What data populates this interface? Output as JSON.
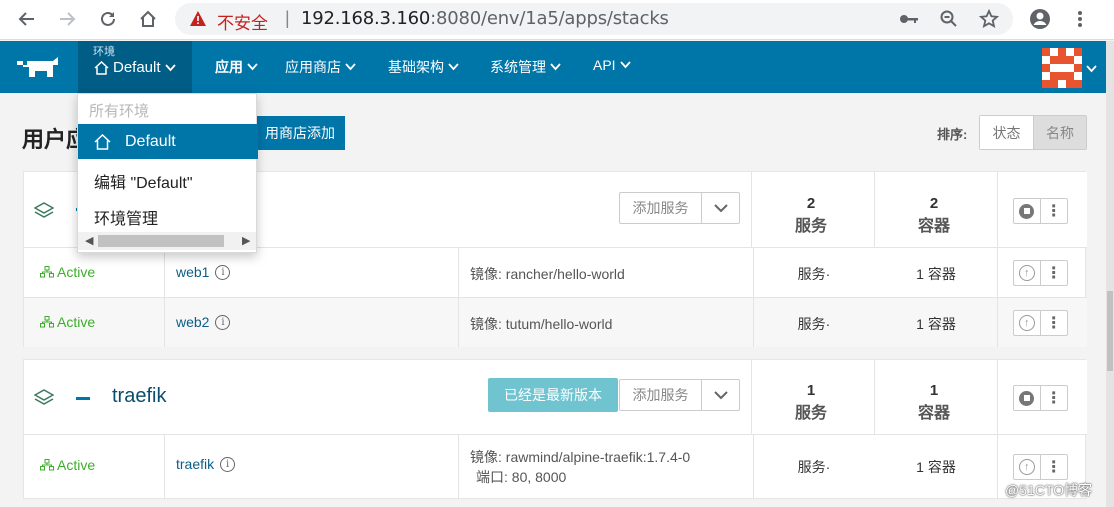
{
  "browser": {
    "insecure_label": "不安全",
    "separator": "|",
    "url_host": "192.168.3.160",
    "url_path": ":8080/env/1a5/apps/stacks"
  },
  "header": {
    "env_label": "环境",
    "env_value": "Default",
    "menus": [
      "应用",
      "应用商店",
      "基础架构",
      "系统管理",
      "API"
    ]
  },
  "env_dropdown": {
    "header": "所有环境",
    "selected": "Default",
    "items": [
      "编辑 \"Default\"",
      "环境管理"
    ]
  },
  "page": {
    "title": "用户应",
    "add_from_catalog": "用商店添加",
    "sort_label": "排序:",
    "sort_options": [
      "状态",
      "名称"
    ]
  },
  "stacks": [
    {
      "name": "",
      "add_service_label": "添加服务",
      "services_count": "2",
      "services_label": "服务",
      "containers_count": "2",
      "containers_label": "容器",
      "rows": [
        {
          "status": "Active",
          "name": "web1",
          "image": "镜像: rancher/hello-world",
          "service_col": "服务·",
          "container_col": "1 容器"
        },
        {
          "status": "Active",
          "name": "web2",
          "image": "镜像: tutum/hello-world",
          "service_col": "服务·",
          "container_col": "1 容器"
        }
      ]
    },
    {
      "name": "traefik",
      "upgrade_label": "已经是最新版本",
      "add_service_label": "添加服务",
      "services_count": "1",
      "services_label": "服务",
      "containers_count": "1",
      "containers_label": "容器",
      "rows": [
        {
          "status": "Active",
          "name": "traefik",
          "image": "镜像: rawmind/alpine-traefik:1.7.4-0",
          "port": "端口: 80,  8000",
          "service_col": "服务·",
          "container_col": "1 容器"
        }
      ]
    }
  ],
  "watermark": "@51CTO博客",
  "colors": {
    "brand": "#0075a8",
    "brand_dark": "#005d86",
    "active_green": "#3dae2b",
    "upgrade": "#70c4d0"
  }
}
